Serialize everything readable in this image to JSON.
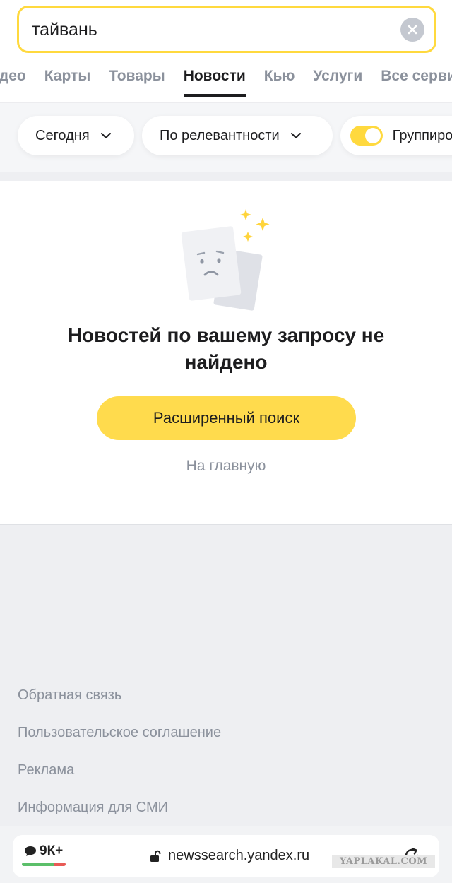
{
  "search": {
    "value": "тайвань"
  },
  "tabs": [
    {
      "label": "идео"
    },
    {
      "label": "Карты"
    },
    {
      "label": "Товары"
    },
    {
      "label": "Новости",
      "active": true
    },
    {
      "label": "Кью"
    },
    {
      "label": "Услуги"
    },
    {
      "label": "Все сервисы"
    }
  ],
  "filters": {
    "period": "Сегодня",
    "sort": "По релевантности",
    "group_label": "Группировать",
    "group_enabled": true
  },
  "empty_state": {
    "title": "Новостей по вашему запросу не найдено",
    "primary_button": "Расширенный поиск",
    "home_link": "На главную"
  },
  "footer": {
    "links": [
      "Обратная связь",
      "Пользовательское соглашение",
      "Реклама",
      "Информация для СМИ"
    ]
  },
  "browser": {
    "comments_count": "9К+",
    "url": "newssearch.yandex.ru",
    "rating": {
      "positive_fraction": 0.72
    }
  },
  "watermark": "YAPLAKAL.COM",
  "colors": {
    "accent": "#ffdb4d",
    "muted_text": "#8b919c",
    "footer_bg": "#eeeff2"
  }
}
